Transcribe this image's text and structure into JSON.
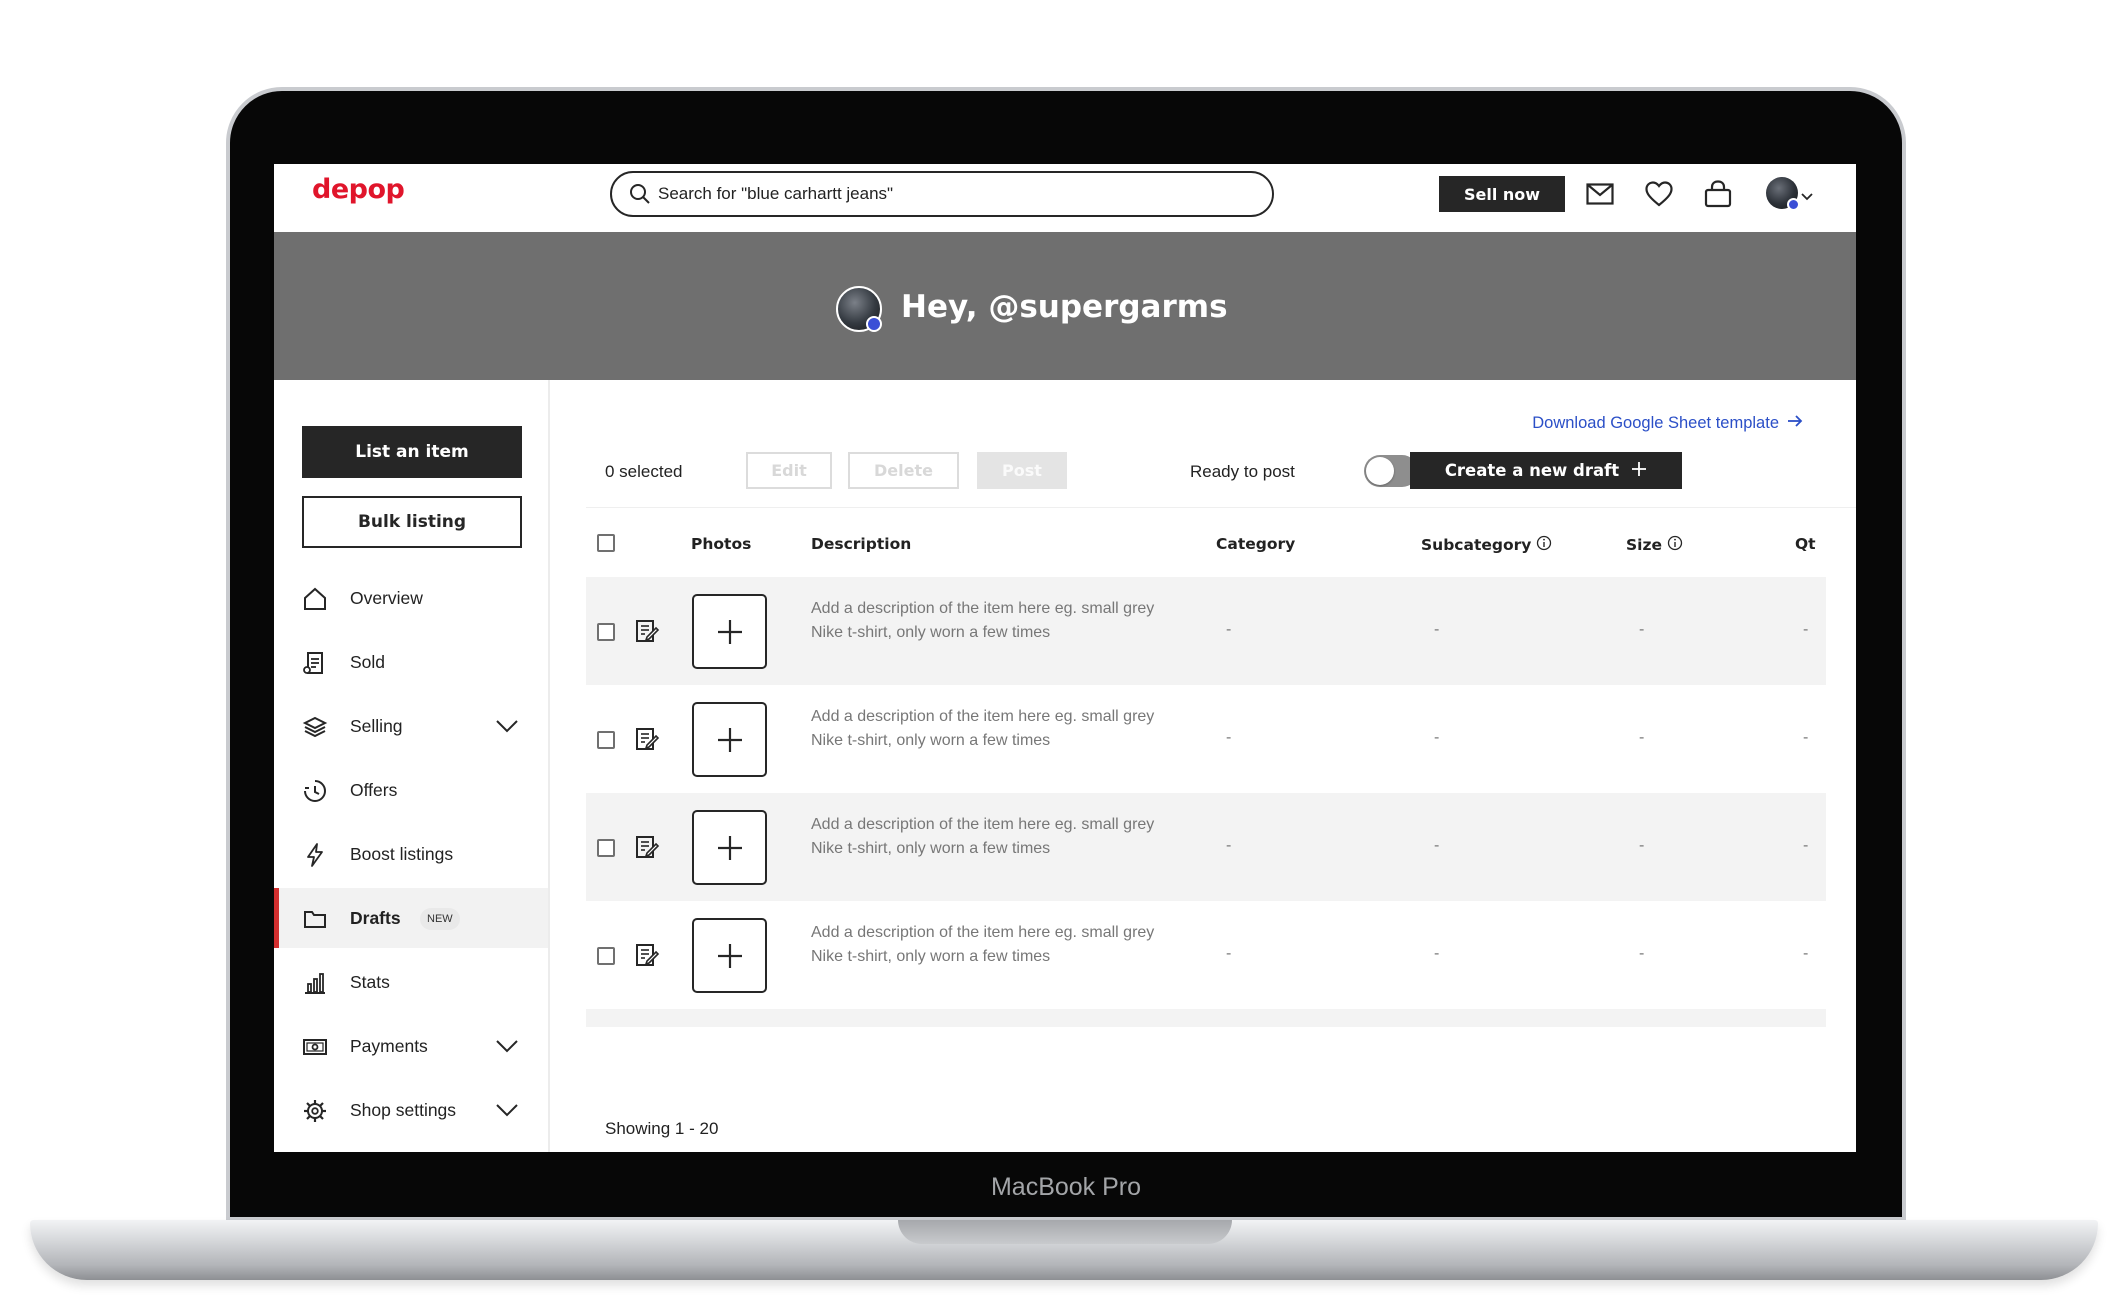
{
  "device": {
    "brand_label": "MacBook Pro"
  },
  "header": {
    "logo": "depop",
    "search_value": "Search for \"blue carhartt jeans\"",
    "sell_now_label": "Sell now"
  },
  "hero": {
    "greeting": "Hey, @supergarms"
  },
  "sidebar": {
    "list_item_label": "List an item",
    "bulk_listing_label": "Bulk listing",
    "items": [
      {
        "label": "Overview",
        "icon": "home-icon",
        "expandable": false
      },
      {
        "label": "Sold",
        "icon": "receipt-icon",
        "expandable": false
      },
      {
        "label": "Selling",
        "icon": "layers-icon",
        "expandable": true
      },
      {
        "label": "Offers",
        "icon": "offers-icon",
        "expandable": false
      },
      {
        "label": "Boost listings",
        "icon": "lightning-icon",
        "expandable": false
      },
      {
        "label": "Drafts",
        "icon": "folder-icon",
        "expandable": false,
        "active": true,
        "tag": "NEW"
      },
      {
        "label": "Stats",
        "icon": "bar-chart-icon",
        "expandable": false
      },
      {
        "label": "Payments",
        "icon": "money-icon",
        "expandable": true
      },
      {
        "label": "Shop settings",
        "icon": "gear-icon",
        "expandable": true
      }
    ]
  },
  "toolbar": {
    "download_link": "Download Google Sheet template",
    "selected_count": "0 selected",
    "edit_label": "Edit",
    "delete_label": "Delete",
    "post_label": "Post",
    "ready_to_post_label": "Ready to post",
    "ready_to_post_on": false,
    "create_draft_label": "Create a new draft"
  },
  "table": {
    "columns": {
      "photos": "Photos",
      "description": "Description",
      "category": "Category",
      "subcategory": "Subcategory",
      "size": "Size",
      "quantity": "Qt"
    },
    "rows": [
      {
        "description": "Add a description of the item here eg. small grey Nike t-shirt, only worn a few times",
        "category": "-",
        "subcategory": "-",
        "size": "-",
        "quantity": "-"
      },
      {
        "description": "Add a description of the item here eg. small grey Nike t-shirt, only worn a few times",
        "category": "-",
        "subcategory": "-",
        "size": "-",
        "quantity": "-"
      },
      {
        "description": "Add a description of the item here eg. small grey Nike t-shirt, only worn a few times",
        "category": "-",
        "subcategory": "-",
        "size": "-",
        "quantity": "-"
      },
      {
        "description": "Add a description of the item here eg. small grey Nike t-shirt, only worn a few times",
        "category": "-",
        "subcategory": "-",
        "size": "-",
        "quantity": "-"
      }
    ]
  },
  "footer": {
    "showing": "Showing 1 - 20"
  },
  "colors": {
    "brand": "#e0152b",
    "active_marker": "#d32f2f",
    "link": "#2b4fc7",
    "dark": "#262626",
    "hero_bg": "#6f6f6f",
    "verified": "#3b4fd6"
  }
}
